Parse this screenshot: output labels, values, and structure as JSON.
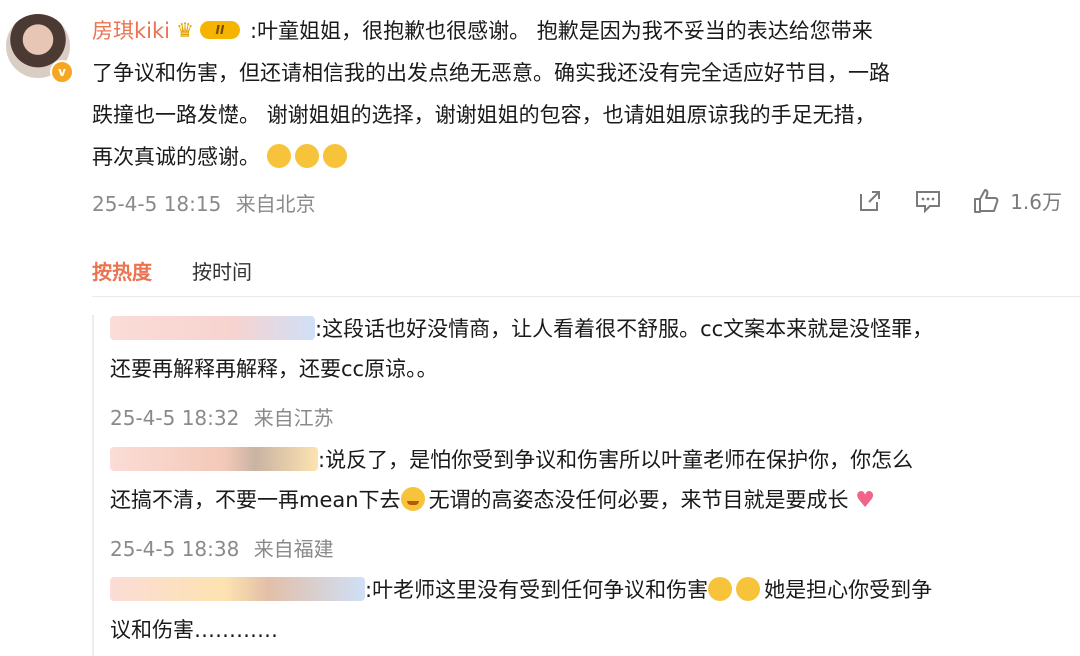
{
  "post": {
    "username": "房琪kiki",
    "level_badge": "II",
    "vip_badge": "v",
    "text_line1": ":叶童姐姐，很抱歉也很感谢。 抱歉是因为我不妥当的表达给您带来",
    "text_line2": "了争议和伤害，但还请相信我的出发点绝无恶意。确实我还没有完全适应好节目，一路",
    "text_line3": "跌撞也一路发憷。 谢谢姐姐的选择，谢谢姐姐的包容，也请姐姐原谅我的手足无措，",
    "text_line4": "再次真诚的感谢。",
    "timestamp": "25-4-5 18:15",
    "location": "来自北京",
    "like_count": "1.6万",
    "icons": [
      "share-icon",
      "comment-icon",
      "like-icon"
    ]
  },
  "sort_tabs": {
    "hot": "按热度",
    "time": "按时间"
  },
  "replies": [
    {
      "line1": ":这段话也好没情商，让人看着很不舒服。cc文案本来就是没怪罪，",
      "line2": "还要再解释再解释，还要cc原谅。。",
      "timestamp": "25-4-5 18:32",
      "location": "来自江苏"
    },
    {
      "line1_a": ":说反了，是怕你受到争议和伤害所以叶童老师在保护你，你怎么",
      "line2_a": "还搞不清，不要一再mean下去",
      "line2_b": "无谓的高姿态没任何必要，来节目就是要成长",
      "timestamp": "25-4-5 18:38",
      "location": "来自福建"
    },
    {
      "line1_a": ":叶老师这里没有受到任何争议和伤害",
      "line1_b": "她是担心你受到争",
      "line2": "议和伤害…………"
    }
  ]
}
